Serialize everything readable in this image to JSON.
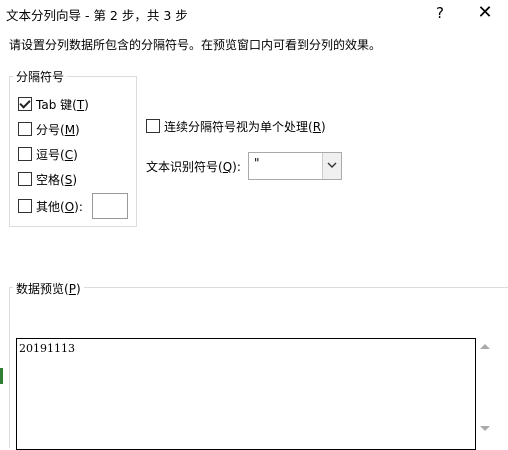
{
  "window": {
    "title": "文本分列向导 - 第 2 步，共 3 步",
    "help_label": "?",
    "close_label": "✕"
  },
  "instruction": "请设置分列数据所包含的分隔符号。在预览窗口内可看到分列的效果。",
  "delimiters": {
    "group_label": "分隔符号",
    "tab": {
      "text": "Tab 键(",
      "key": "T",
      "end": ")",
      "checked": true
    },
    "semicolon": {
      "text": "分号(",
      "key": "M",
      "end": ")",
      "checked": false
    },
    "comma": {
      "text": "逗号(",
      "key": "C",
      "end": ")",
      "checked": false
    },
    "space": {
      "text": "空格(",
      "key": "S",
      "end": ")",
      "checked": false
    },
    "other": {
      "text": "其他(",
      "key": "O",
      "end": "):",
      "checked": false,
      "value": ""
    }
  },
  "consecutive": {
    "text": "连续分隔符号视为单个处理(",
    "key": "R",
    "end": ")",
    "checked": false
  },
  "text_qualifier": {
    "text": "文本识别符号(",
    "key": "Q",
    "end": "):",
    "value": "\""
  },
  "preview": {
    "text": "数据预览(",
    "key": "P",
    "end": ")",
    "rows": [
      "20191113"
    ]
  }
}
